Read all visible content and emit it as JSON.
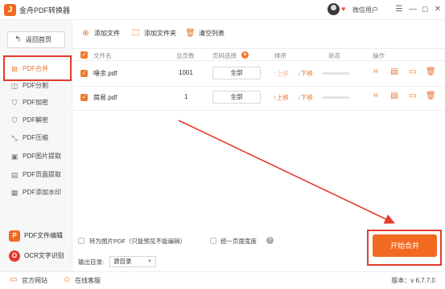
{
  "window": {
    "title": "金舟PDF转换器",
    "logo_glyph": "J",
    "user_name": "微信用户",
    "controls": [
      "☰",
      "—",
      "☐",
      "✕"
    ]
  },
  "sidebar": {
    "back_label": "返回首页",
    "items": [
      {
        "label": "PDF合并",
        "icon": "merge-icon",
        "glyph": "⊞",
        "active": true
      },
      {
        "label": "PDF分割",
        "icon": "split-icon",
        "glyph": "◫",
        "active": false
      },
      {
        "label": "PDF加密",
        "icon": "encrypt-icon",
        "glyph": "⛉",
        "active": false
      },
      {
        "label": "PDF解密",
        "icon": "decrypt-icon",
        "glyph": "⛉",
        "active": false
      },
      {
        "label": "PDF压缩",
        "icon": "compress-icon",
        "glyph": "⤡",
        "active": false
      },
      {
        "label": "PDF图片提取",
        "icon": "image-extract-icon",
        "glyph": "▣",
        "active": false
      },
      {
        "label": "PDF页面提取",
        "icon": "page-extract-icon",
        "glyph": "▤",
        "active": false
      },
      {
        "label": "PDF添加水印",
        "icon": "watermark-icon",
        "glyph": "▦",
        "active": false
      }
    ],
    "pdf_edit_label": "PDF文件编辑",
    "pdf_edit_glyph": "P",
    "ocr_label": "OCR文字识别",
    "ocr_glyph": "O"
  },
  "toolbar": {
    "add_file": "添加文件",
    "add_folder": "添加文件夹",
    "clear_list": "清空列表"
  },
  "table": {
    "headers": {
      "name": "文件名",
      "pages": "总页数",
      "page_select": "页码选择",
      "sort": "排序",
      "status": "状态",
      "ops": "操作"
    },
    "rows": [
      {
        "name": "唾余.pdf",
        "pages": "1001",
        "page_select": "全部",
        "up": "上移",
        "down": "下移",
        "status_progress": 0
      },
      {
        "name": "简易.pdf",
        "pages": "1",
        "page_select": "全部",
        "up": "上移",
        "down": "下移",
        "status_progress": 0
      }
    ]
  },
  "options": {
    "to_image_label": "转为图片PDF（只能预览不能编辑）",
    "unify_width_label": "统一页面宽度",
    "help_glyph": "?",
    "output_dir_label": "输出目录:",
    "output_dir_value": "源目录",
    "start_label": "开始合并"
  },
  "footer": {
    "website": "官方网站",
    "service": "在线客服",
    "version": "版本：v 6.7.7.0"
  },
  "colors": {
    "accent": "#f26a21",
    "highlight_frame": "#e53b2c"
  }
}
